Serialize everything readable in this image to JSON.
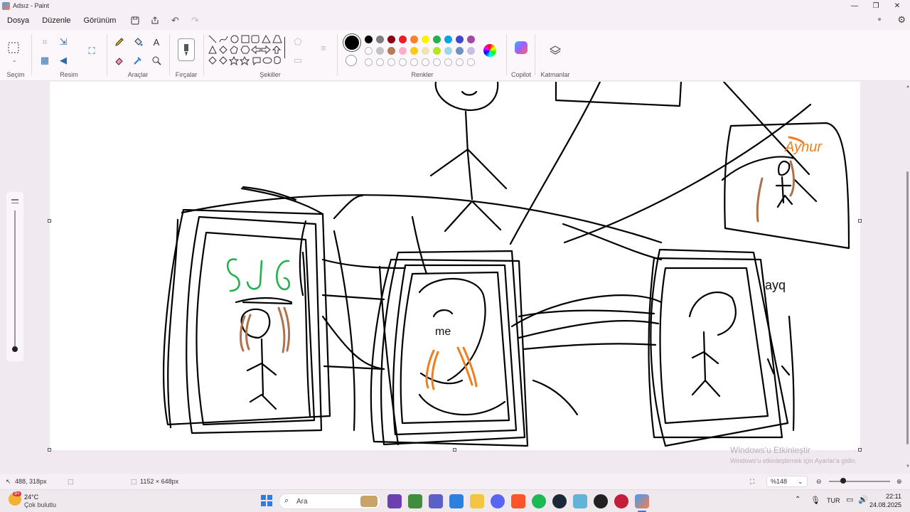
{
  "window": {
    "title": "Adsız - Paint"
  },
  "menu": {
    "file": "Dosya",
    "edit": "Düzenle",
    "view": "Görünüm"
  },
  "ribbon": {
    "groups": {
      "selection": "Seçim",
      "image": "Resim",
      "tools": "Araçlar",
      "brushes": "Fırçalar",
      "shapes": "Şekiller",
      "colors": "Renkler",
      "copilot": "Copilot",
      "layers": "Katmanlar"
    },
    "palette_row1": [
      "#000000",
      "#7f7f7f",
      "#880015",
      "#ed1c24",
      "#ff7f27",
      "#fff200",
      "#22b14c",
      "#00a2e8",
      "#3f48cc",
      "#a349a4"
    ],
    "palette_row2": [
      "#ffffff",
      "#c3c3c3",
      "#b97a57",
      "#ffaec9",
      "#ffc90e",
      "#efe4b0",
      "#b5e61d",
      "#99d9ea",
      "#7092be",
      "#c8bfe7"
    ],
    "primary_color": "#000000",
    "secondary_color": "#ffffff"
  },
  "drawing": {
    "label_sjg": "SJG",
    "label_me": "me",
    "label_aynur": "Aynur",
    "label_ayg": "ayq"
  },
  "status": {
    "cursor": "488, 318px",
    "canvas_size": "1152 × 648px",
    "zoom": "%148"
  },
  "watermark": {
    "title": "Windows'u Etkinleştir",
    "subtitle": "Windows'u etkinleştirmek için Ayarlar'a gidin."
  },
  "taskbar": {
    "weather_temp": "24°C",
    "weather_desc": "Çok bulutlu",
    "search_placeholder": "Ara",
    "language": "TUR",
    "time": "22:11",
    "date": "24.08.2025",
    "notification_badge": "9+"
  }
}
